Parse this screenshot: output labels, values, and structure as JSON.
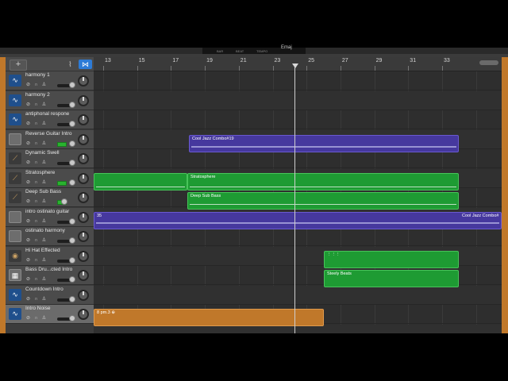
{
  "lcd": {
    "bar": "BAR",
    "beat": "BEAT",
    "tempo": "TEMPO",
    "key": "Emaj"
  },
  "header": {
    "add_label": "+"
  },
  "ruler": {
    "ticks": [
      "13",
      "15",
      "17",
      "19",
      "21",
      "23",
      "25",
      "27",
      "29",
      "31",
      "33"
    ]
  },
  "tracks": [
    {
      "name": "harmony 1",
      "icon": "waveform-icon"
    },
    {
      "name": "harmony 2",
      "icon": "waveform-icon"
    },
    {
      "name": "antiphonal respone",
      "icon": "waveform-icon"
    },
    {
      "name": "Reverse Guitar Intro",
      "icon": "folder-icon"
    },
    {
      "name": "Dynamic Swell",
      "icon": "guitar-icon"
    },
    {
      "name": "Stratosphere",
      "icon": "guitar-icon"
    },
    {
      "name": "Deep Sub Bass",
      "icon": "guitar-icon"
    },
    {
      "name": "intro ostinato guitar",
      "icon": "folder-icon"
    },
    {
      "name": "ostinato harmony",
      "icon": "folder-icon"
    },
    {
      "name": "Hi Hat Effected",
      "icon": "drum-icon"
    },
    {
      "name": "Bass Dru...cted Intro",
      "icon": "drum-machine-icon"
    },
    {
      "name": "Countdown Intro",
      "icon": "waveform-icon"
    },
    {
      "name": "Intro Noise",
      "icon": "waveform-icon"
    }
  ],
  "regions": {
    "cool_jazz_1": "Cool Jazz Combo#19",
    "stratosphere": "Stratosphere",
    "deep_sub_bass": "Deep Sub Bass",
    "ostinato_left": "35",
    "ostinato_right": "Cool Jazz Combo#",
    "hihat": "⋮⋮⋮",
    "steely": "Steely Beats",
    "intro_noise": "8 pm.3 ⊕"
  },
  "colors": {
    "purple": "#46389e",
    "green": "#1e9b33",
    "orange": "#c0782a",
    "accent": "#2d7bd6"
  }
}
